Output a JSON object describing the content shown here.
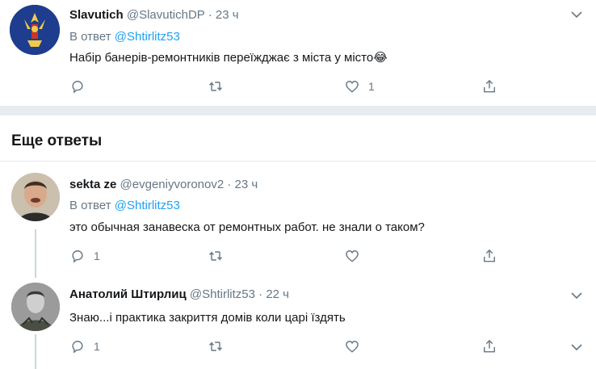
{
  "tweets": [
    {
      "name": "Slavutich",
      "handle": "@SlavutichDP",
      "time": "23 ч",
      "reply_prefix": "В ответ",
      "reply_mention": "@Shtirlitz53",
      "text": "Набір банерів-ремонтників переїжджає з міста у місто😂",
      "replies": "",
      "retweets": "",
      "likes": "1"
    },
    {
      "name": "sekta ze",
      "handle": "@evgeniyvoronov2",
      "time": "23 ч",
      "reply_prefix": "В ответ",
      "reply_mention": "@Shtirlitz53",
      "text": "это обычная занавеска от ремонтных работ. не знали о таком?",
      "replies": "1",
      "retweets": "",
      "likes": ""
    },
    {
      "name": "Анатолий Штирлиц",
      "handle": "@Shtirlitz53",
      "time": "22 ч",
      "text": "Знаю...і практика закриття домів коли царі їздять",
      "replies": "1",
      "retweets": "",
      "likes": ""
    }
  ],
  "section_title": "Еще ответы",
  "separator_dot": "·",
  "colors": {
    "accent": "#1da1f2",
    "muted": "#657786",
    "separator": "#e6ecf0"
  }
}
